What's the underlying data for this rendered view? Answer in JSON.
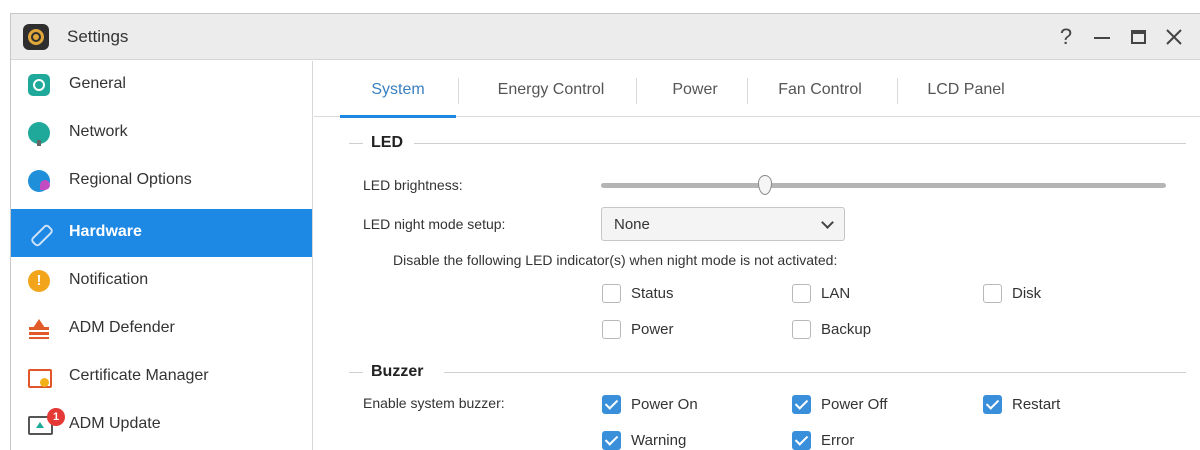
{
  "window": {
    "title": "Settings"
  },
  "titlebar_buttons": {
    "help": "?"
  },
  "sidebar": {
    "items": [
      {
        "label": "General",
        "icon": "general-icon"
      },
      {
        "label": "Network",
        "icon": "network-icon"
      },
      {
        "label": "Regional Options",
        "icon": "regional-options-icon"
      },
      {
        "label": "Hardware",
        "icon": "hardware-icon",
        "active": true
      },
      {
        "label": "Notification",
        "icon": "notification-icon",
        "glyph": "!"
      },
      {
        "label": "ADM Defender",
        "icon": "adm-defender-icon"
      },
      {
        "label": "Certificate Manager",
        "icon": "certificate-icon"
      },
      {
        "label": "ADM Update",
        "icon": "adm-update-icon",
        "badge": "1"
      }
    ]
  },
  "tabs": [
    {
      "label": "System",
      "active": true
    },
    {
      "label": "Energy Control"
    },
    {
      "label": "Power"
    },
    {
      "label": "Fan Control"
    },
    {
      "label": "LCD Panel"
    }
  ],
  "led": {
    "title": "LED",
    "brightness_label": "LED brightness:",
    "brightness_level": 0.29,
    "night_mode_label": "LED night mode setup:",
    "night_mode_value": "None",
    "disable_text": "Disable the following LED indicator(s) when night mode is not activated:",
    "indicators": [
      {
        "label": "Status",
        "checked": false
      },
      {
        "label": "LAN",
        "checked": false
      },
      {
        "label": "Disk",
        "checked": false
      },
      {
        "label": "Power",
        "checked": false
      },
      {
        "label": "Backup",
        "checked": false
      }
    ]
  },
  "buzzer": {
    "title": "Buzzer",
    "enable_label": "Enable system buzzer:",
    "options": [
      {
        "label": "Power On",
        "checked": true
      },
      {
        "label": "Power Off",
        "checked": true
      },
      {
        "label": "Restart",
        "checked": true
      },
      {
        "label": "Warning",
        "checked": true
      },
      {
        "label": "Error",
        "checked": true
      }
    ]
  },
  "colors": {
    "accent": "#1e88e5",
    "checkbox": "#3a8fdb",
    "badge": "#e53935"
  }
}
